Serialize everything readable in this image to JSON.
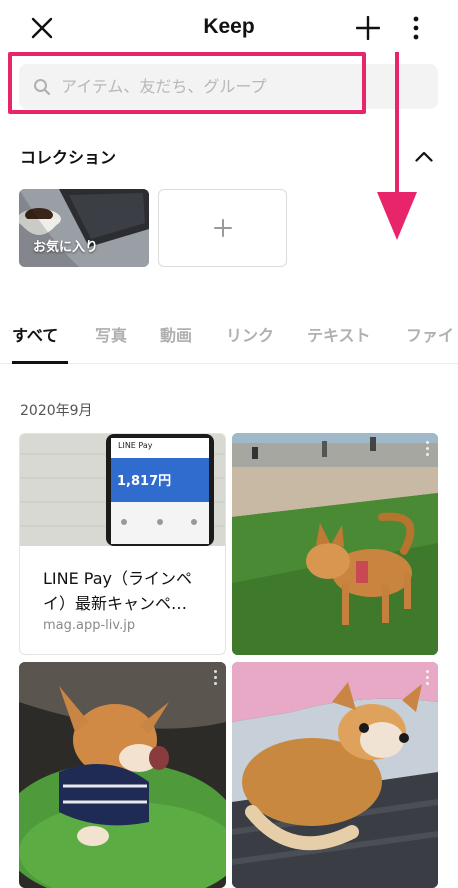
{
  "header": {
    "title": "Keep",
    "close_icon": "close-icon",
    "add_icon": "plus-icon",
    "more_icon": "more-vertical-icon"
  },
  "search": {
    "placeholder": "アイテム、友だち、グループ",
    "value": "",
    "icon": "search-icon"
  },
  "collection": {
    "title": "コレクション",
    "toggle_icon": "chevron-up-icon",
    "items": [
      {
        "label": "お気に入り"
      }
    ],
    "add_icon": "plus-icon"
  },
  "tabs": [
    {
      "label": "すべて",
      "active": true
    },
    {
      "label": "写真",
      "active": false
    },
    {
      "label": "動画",
      "active": false
    },
    {
      "label": "リンク",
      "active": false
    },
    {
      "label": "テキスト",
      "active": false
    },
    {
      "label": "ファイ",
      "active": false
    }
  ],
  "group_date": "2020年9月",
  "items": [
    {
      "type": "link",
      "title": "LINE Pay（ラインペイ）最新キャンペ…",
      "url": "mag.app-liv.jp",
      "thumb": {
        "app_name": "LINE Pay",
        "balance": "1,817円"
      }
    },
    {
      "type": "photo",
      "subject": "chihuahua on grass"
    },
    {
      "type": "photo",
      "subject": "chihuahua yawning on green cushion"
    },
    {
      "type": "photo",
      "subject": "chihuahua curled on sofa"
    }
  ],
  "colors": {
    "accent": "#e8246b",
    "tab_active": "#111111",
    "tab_inactive": "#b0b0b0"
  }
}
